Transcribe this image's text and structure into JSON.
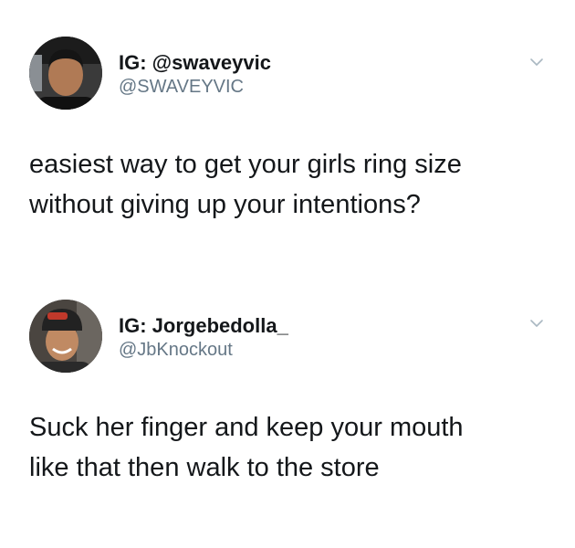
{
  "tweets": [
    {
      "name": "IG: @swaveyvic",
      "handle": "@SWAVEYVIC",
      "text_lines": [
        "easiest way to get your girls ring size",
        "without giving up your intentions?"
      ],
      "avatar_icon": "profile-photo",
      "menu_icon": "chevron-down-icon"
    },
    {
      "name": "IG: Jorgebedolla_",
      "handle": "@JbKnockout",
      "text_lines": [
        "Suck her finger and keep your mouth",
        "like that then walk to the store"
      ],
      "avatar_icon": "profile-photo",
      "menu_icon": "chevron-down-icon"
    }
  ],
  "colors": {
    "background": "#ffffff",
    "name": "#14171a",
    "handle": "#657786",
    "chevron": "#aab8c2"
  }
}
